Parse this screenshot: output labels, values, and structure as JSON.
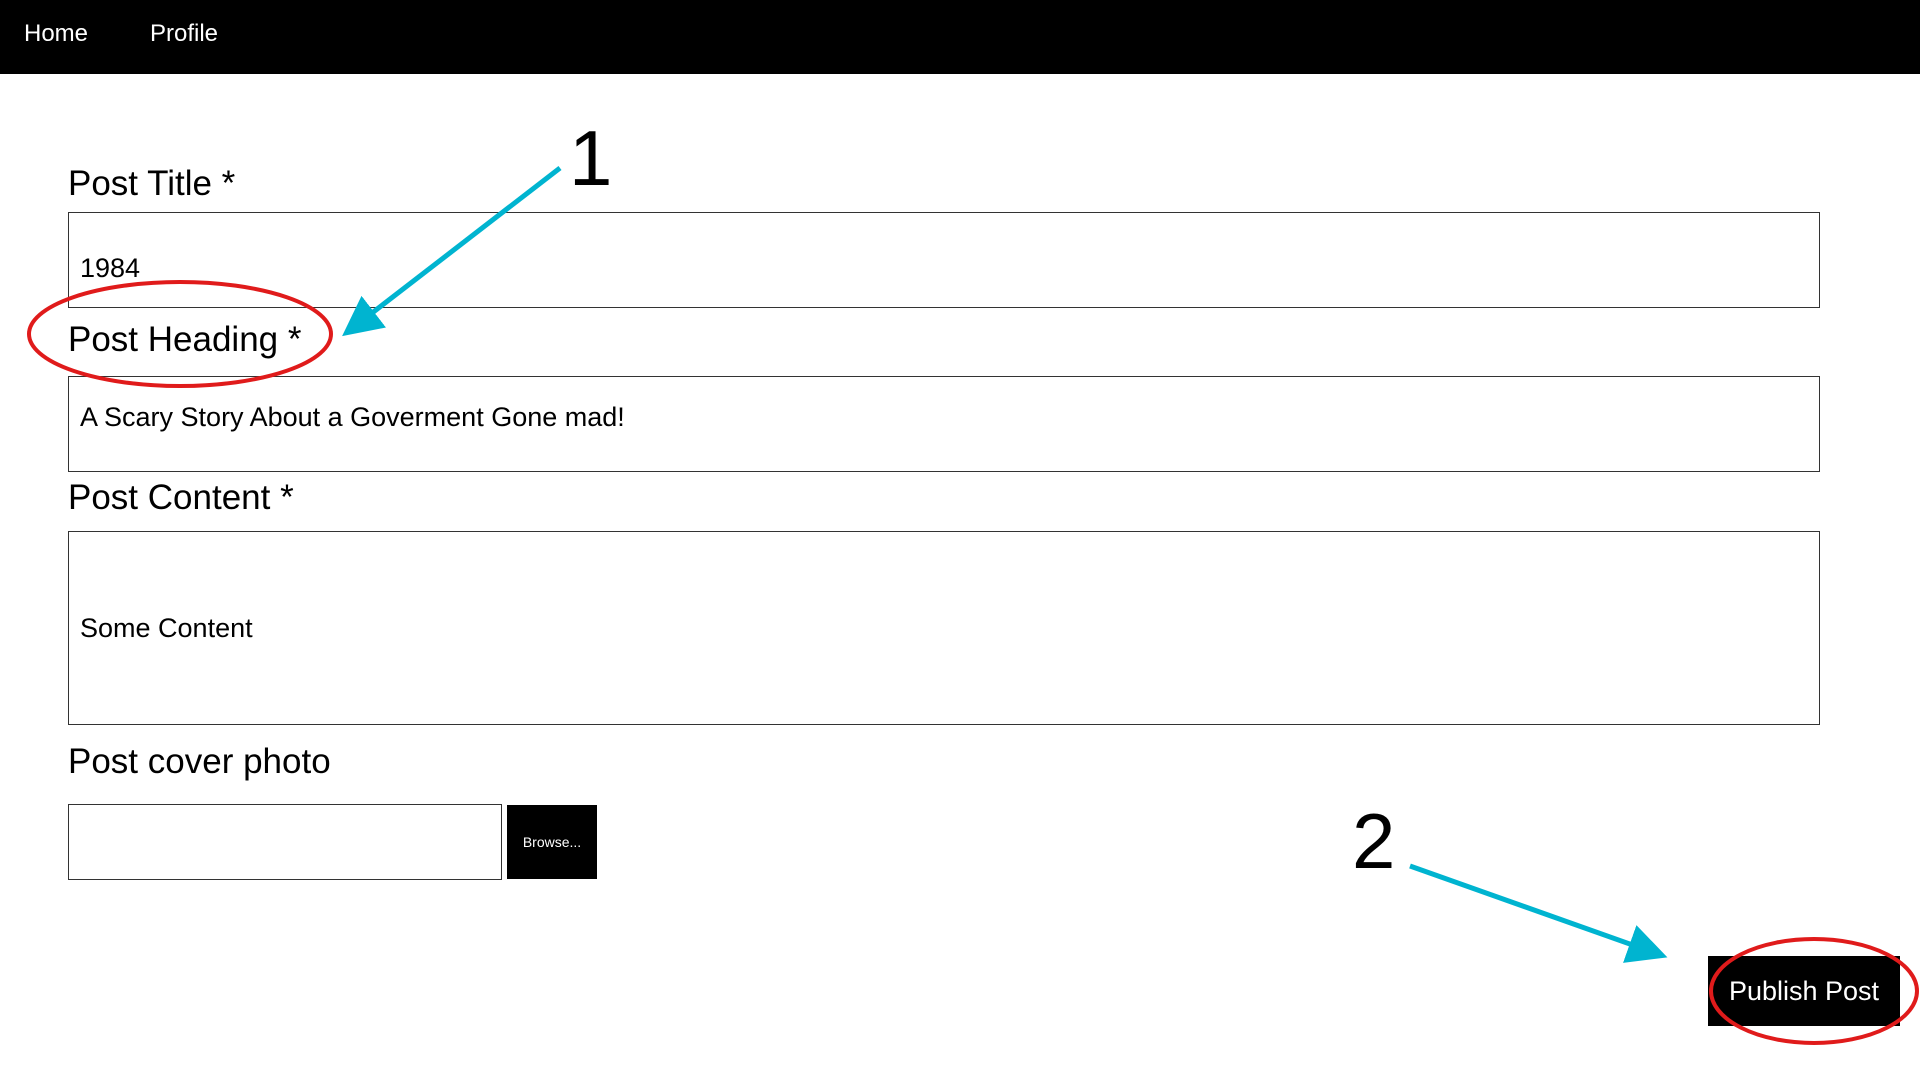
{
  "nav": {
    "home_label": "Home",
    "profile_label": "Profile"
  },
  "form": {
    "title_label": "Post Title *",
    "title_value": "1984",
    "heading_label": "Post Heading *",
    "heading_value": "A Scary Story About a Goverment Gone mad!",
    "content_label": "Post Content *",
    "content_value": "Some Content",
    "photo_label": "Post cover photo",
    "browse_label": "Browse...",
    "publish_label": "Publish Post"
  },
  "annotations": {
    "marker_1": "1",
    "marker_2": "2",
    "arrow_color": "#00b4d0",
    "circle_color": "#e01b1b"
  }
}
